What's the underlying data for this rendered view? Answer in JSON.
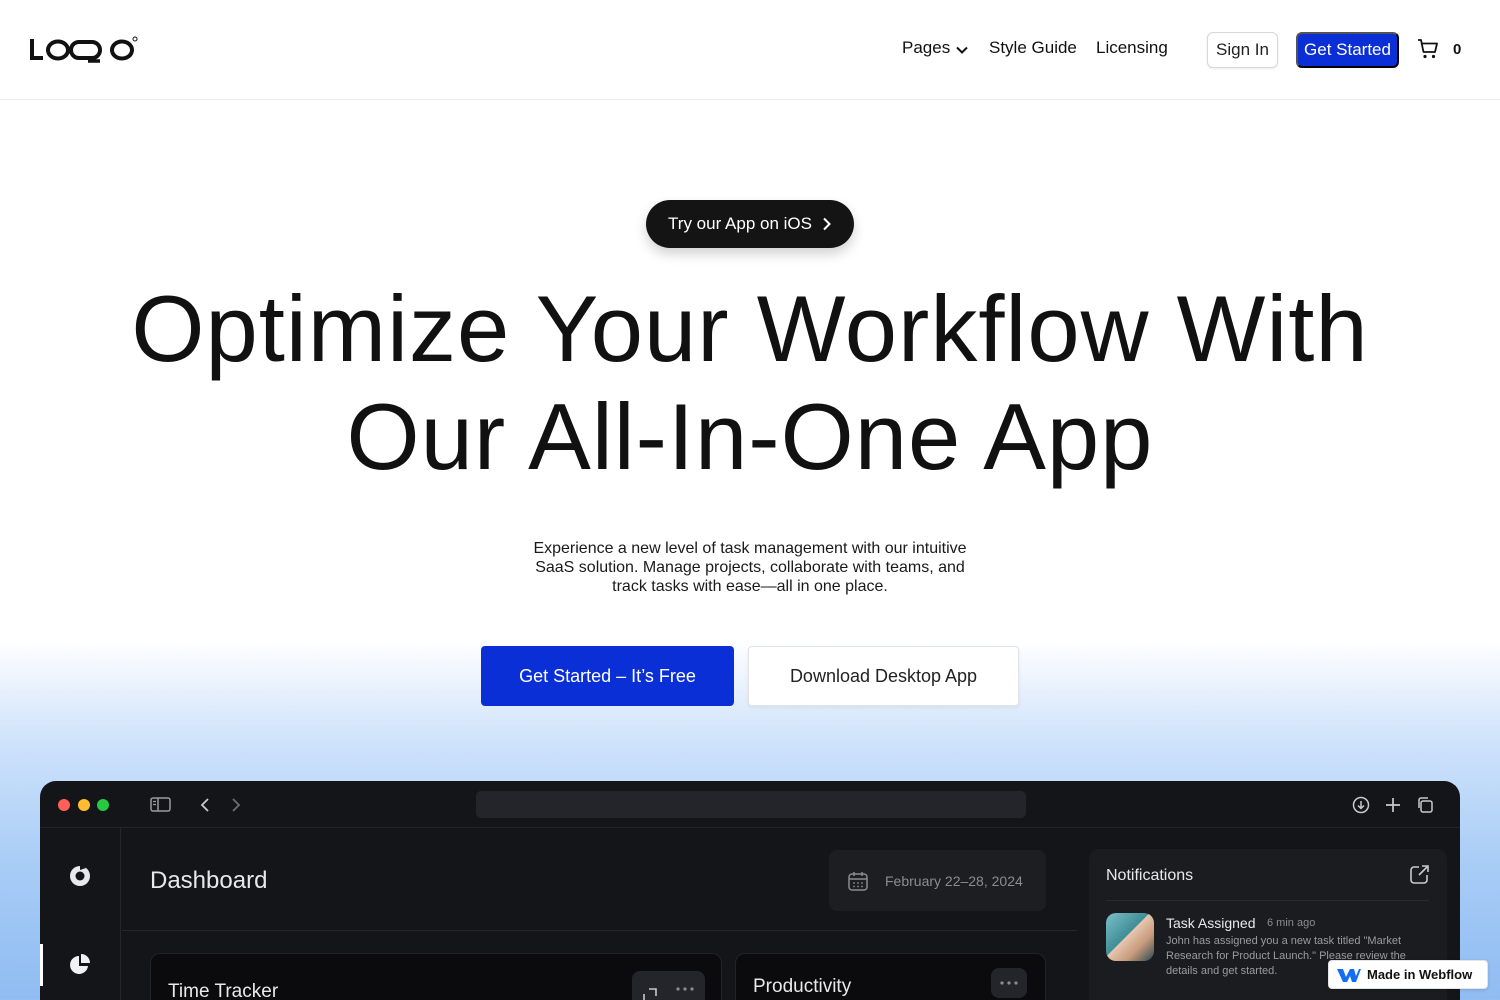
{
  "header": {
    "logo_alt": "LOGO",
    "nav": [
      {
        "label": "Pages"
      },
      {
        "label": "Style Guide"
      },
      {
        "label": "Licensing"
      }
    ],
    "sign_in_label": "Sign In",
    "get_started_label": "Get Started",
    "cart_count": "0"
  },
  "hero": {
    "pill_label": "Try our App on iOS",
    "title_line1": "Optimize Your Workflow With",
    "title_line2": "Our All-In-One App",
    "subtitle": "Experience a new level of task management with our intuitive SaaS solution. Manage projects, collaborate with teams, and track tasks with ease—all in one place.",
    "primary_cta": "Get Started – It’s Free",
    "secondary_cta": "Download Desktop App"
  },
  "app": {
    "dashboard_title": "Dashboard",
    "date_range": "February 22–28, 2024",
    "cards": [
      {
        "title": "Time Tracker"
      },
      {
        "title": "Productivity"
      }
    ],
    "notifications": {
      "title": "Notifications",
      "items": [
        {
          "name": "Task Assigned",
          "time": "6 min ago",
          "body": "John has assigned you a new task titled \"Market Research for Product Launch.\" Please review the details and get started."
        }
      ]
    }
  },
  "badge": {
    "label": "Made in Webflow"
  },
  "colors": {
    "accent": "#0b2fd6",
    "dark": "#141518"
  }
}
